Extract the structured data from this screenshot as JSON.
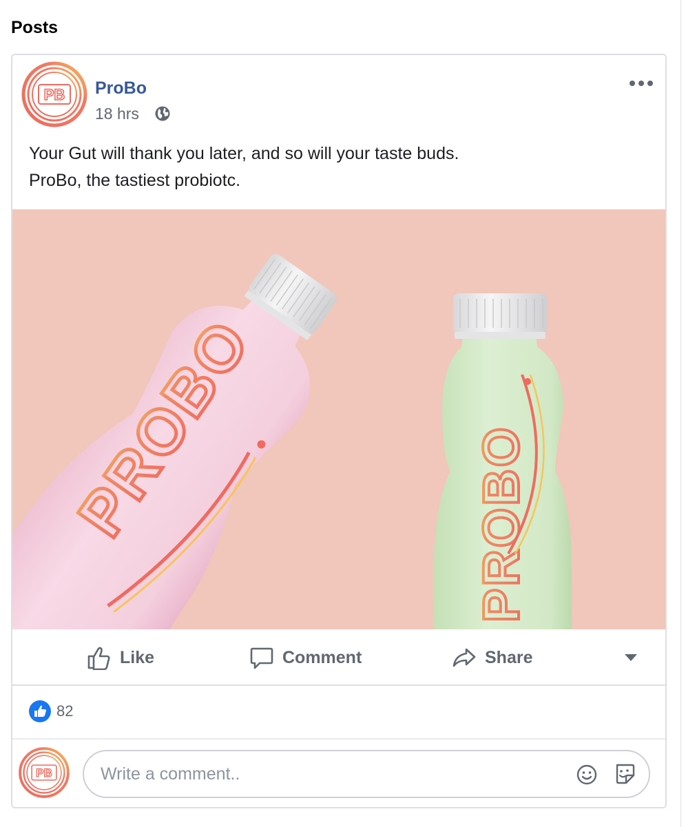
{
  "section": {
    "title": "Posts"
  },
  "post": {
    "page_name": "ProBo",
    "timestamp": "18 hrs",
    "privacy_icon": "globe-icon",
    "menu_icon": "more-dots-icon",
    "text_line_1": "Your Gut will thank you later, and so will your taste buds.",
    "text_line_2": "ProBo, the tastiest probiotc.",
    "avatar_initials": "PB",
    "image": {
      "background_color": "#f1c6bb",
      "bottles": [
        {
          "label": "PROBO",
          "color": "#f6d3e1",
          "cap_color": "#e9e9ea"
        },
        {
          "label": "PROBO",
          "color": "#d6ebcc",
          "cap_color": "#e9e9ea"
        }
      ]
    }
  },
  "actions": {
    "like": "Like",
    "comment": "Comment",
    "share": "Share",
    "audience_caret_icon": "caret-down-icon"
  },
  "reactions": {
    "count": "82",
    "icon": "like-reaction-icon",
    "color": "#1877f2"
  },
  "comment_input": {
    "placeholder": "Write a comment..",
    "emoji_icon": "emoji-icon",
    "sticker_icon": "sticker-icon"
  },
  "colors": {
    "link_blue": "#385898",
    "text_secondary": "#606770",
    "brand_coral": "#ef6b5f",
    "brand_yellow": "#f7c45a"
  }
}
